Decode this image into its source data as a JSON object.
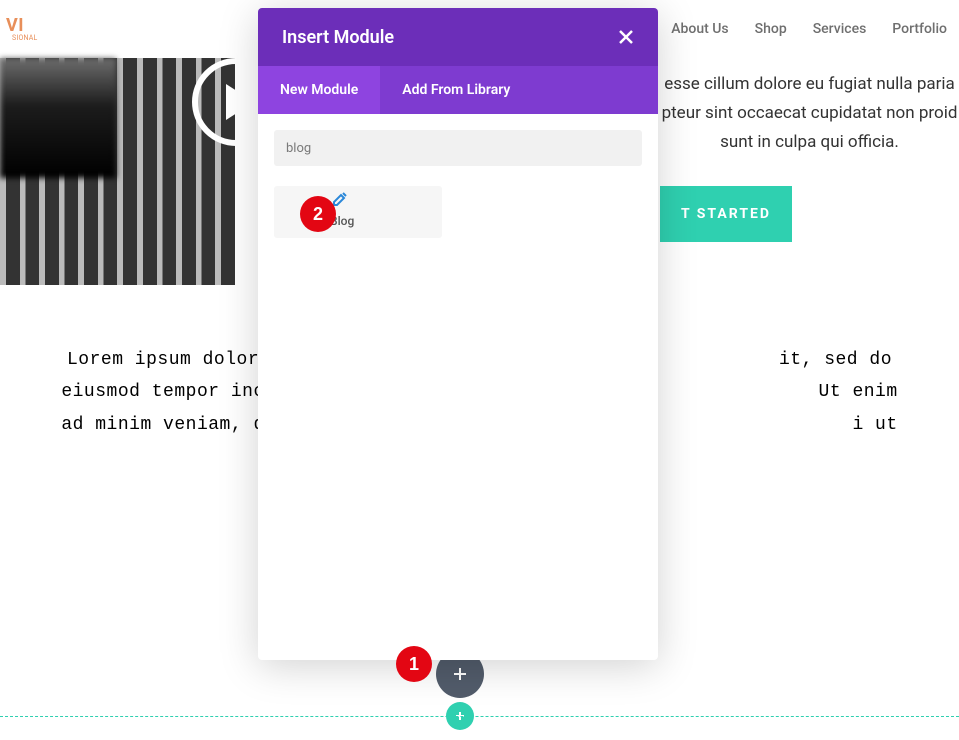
{
  "logo": {
    "text": "VI",
    "subtext": "SIONAL"
  },
  "nav": {
    "about": "About Us",
    "shop": "Shop",
    "services": "Services",
    "portfolio": "Portfolio"
  },
  "hero": {
    "line1": "esse cillum dolore eu fugiat nulla paria",
    "line2": "pteur sint occaecat cupidatat non proid",
    "line3": "sunt in culpa qui officia."
  },
  "cta": {
    "label": "T STARTED"
  },
  "lorem": {
    "text": "Lorem ipsum dolor                                              it, sed do eiusmod tempor incididu                                            Ut enim ad minim veniam, quis nost                                            i ut aliquip ex ea"
  },
  "modal": {
    "title": "Insert Module",
    "tabs": {
      "new": "New Module",
      "library": "Add From Library"
    },
    "search_value": "blog",
    "module": {
      "name": "Blog",
      "icon_name": "edit-icon"
    }
  },
  "markers": {
    "m1": "1",
    "m2": "2"
  }
}
